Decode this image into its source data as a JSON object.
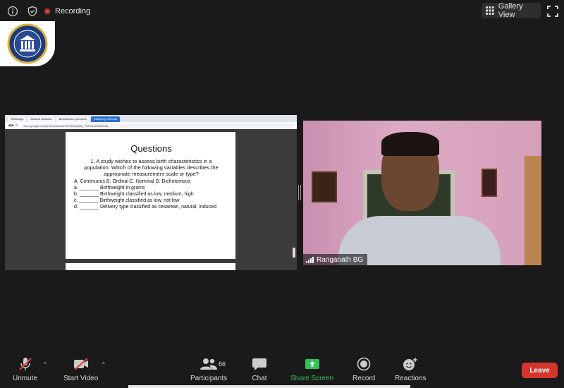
{
  "topbar": {
    "recording_label": "Recording",
    "gallery_view_label": "Gallery View"
  },
  "shared_screen": {
    "browser_tabs": [
      "WhatsApp",
      "Medical statistics",
      "Biostatistics questions",
      "Sampling methods"
    ],
    "url": "docs.google.com/presentation/d/1F59DH8QIM_-72ZVf5nbRAS/edit",
    "slide": {
      "title": "Questions",
      "question": "1. A study wishes to assess birth characteristics in a population. Which of the following variables describes the appropriate measurement scale or type?",
      "choices_line": "A. Continuous B. Ordinal C. Nominal D. Dichotomous",
      "options": [
        {
          "letter": "a.",
          "text": "Birthweight in grams"
        },
        {
          "letter": "b.",
          "text": "Birthweight classified as low, medium, high"
        },
        {
          "letter": "c.",
          "text": "Birthweight classified as low, not low"
        },
        {
          "letter": "d.",
          "text": "Delivery type classified as cesarean, natural, induced"
        }
      ]
    }
  },
  "video": {
    "participant_name": "Ranganath BG"
  },
  "toolbar": {
    "unmute": "Unmute",
    "start_video": "Start Video",
    "participants": "Participants",
    "participants_count": "66",
    "chat": "Chat",
    "share_screen": "Share Screen",
    "record": "Record",
    "reactions": "Reactions",
    "leave": "Leave"
  },
  "colors": {
    "background": "#1a1a1a",
    "share_green": "#33c15a",
    "leave_red": "#d4352c",
    "recording_red": "#e0413a"
  },
  "icons": [
    "info-icon",
    "shield-icon",
    "recording-icon",
    "gallery-grid-icon",
    "fullscreen-icon",
    "mic-muted-icon",
    "video-off-icon",
    "participants-icon",
    "chat-icon",
    "share-screen-icon",
    "record-icon",
    "reactions-icon",
    "signal-bars-icon"
  ]
}
